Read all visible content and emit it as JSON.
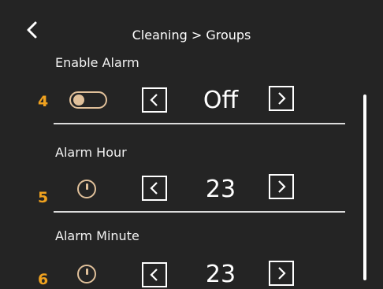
{
  "header": {
    "title": "Cleaning > Groups",
    "back_icon": "chevron-left-icon"
  },
  "settings": [
    {
      "number": "4",
      "label": "Enable Alarm",
      "value": "Off",
      "icon": "toggle-off-icon"
    },
    {
      "number": "5",
      "label": "Alarm Hour",
      "value": "23",
      "icon": "clock-icon"
    },
    {
      "number": "6",
      "label": "Alarm Minute",
      "value": "23",
      "icon": "clock-icon"
    }
  ],
  "colors": {
    "accent": "#f0a21f",
    "icon": "#e0c09a",
    "background": "#242424"
  }
}
